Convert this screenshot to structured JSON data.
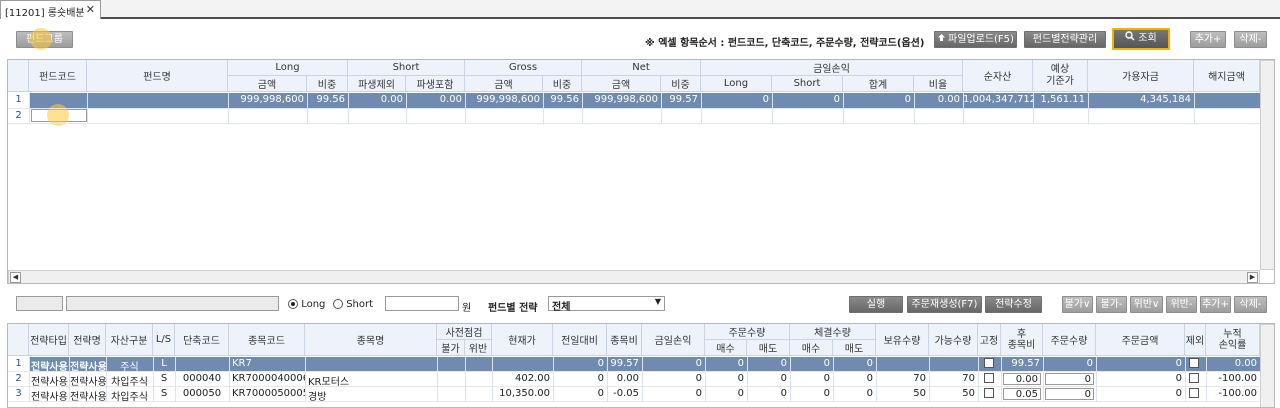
{
  "tab": {
    "title": "[11201] 롱숏배분",
    "close": "✕"
  },
  "toolbar": {
    "fund_group": "펀드그룹",
    "excel_note": "※ 엑셀 항목순서 : 펀드코드, 단축코드, 주문수량, 전략코드(옵션)",
    "upload": "파일업로드(F5)",
    "strategy_manage": "펀드별전략관리",
    "search": "조회",
    "add": "추가+",
    "delete": "삭제-"
  },
  "top_grid": {
    "group_headers": [
      "Long",
      "Short",
      "Gross",
      "Net",
      "금일손익"
    ],
    "headers": {
      "fund_code": "펀드코드",
      "fund_name": "펀드명",
      "long_amt": "금액",
      "long_ratio": "비중",
      "short_ex": "파생제외",
      "short_in": "파생포함",
      "gross_amt": "금액",
      "gross_ratio": "비중",
      "net_amt": "금액",
      "net_ratio": "비중",
      "pl_long": "Long",
      "pl_short": "Short",
      "pl_sum": "합계",
      "pl_rate": "비율",
      "net_asset": "순자산",
      "expected": "예상\n기준가",
      "available": "가용자금",
      "cancel": "해지금액"
    },
    "rows": [
      {
        "no": "1",
        "cells": [
          "999,998,600",
          "99.56",
          "0.00",
          "0.00",
          "999,998,600",
          "99.56",
          "999,998,600",
          "99.57",
          "0",
          "0",
          "0",
          "0.00",
          "1,004,347,712",
          "1,561.11",
          "4,345,184"
        ]
      },
      {
        "no": "2"
      }
    ]
  },
  "mid_toolbar": {
    "long": "Long",
    "short": "Short",
    "won": "원",
    "strategy_label": "펀드별 전략",
    "strategy_value": "전체",
    "run": "실행",
    "order_regen": "주문재생성(F7)",
    "strategy_edit": "전략수정",
    "buttons": [
      "불가∨",
      "불가-",
      "위반∨",
      "위반-",
      "추가+",
      "삭제-"
    ]
  },
  "bottom_grid": {
    "headers": {
      "strategy_type": "전략타입",
      "strategy_name": "전략명",
      "asset_type": "자산구분",
      "ls": "L/S",
      "short_code": "단축코드",
      "item_code": "종목코드",
      "item_name": "종목명",
      "precheck": "사전점검",
      "impossible": "불가",
      "violation": "위반",
      "price": "현재가",
      "change": "전일대비",
      "weight": "종목비",
      "today_pl": "금일손익",
      "order_qty_group": "주문수량",
      "buy": "매수",
      "sell": "매도",
      "exec_qty_group": "체결수량",
      "exec_buy": "매수",
      "exec_sell": "매도",
      "hold_qty": "보유수량",
      "avail_qty": "가능수량",
      "fixed": "고정",
      "after_weight": "후\n종목비",
      "order_qty": "주문수량",
      "order_amt": "주문금액",
      "exclude": "제외",
      "cum_rate": "누적\n손익률"
    },
    "rows": [
      {
        "no": "1",
        "st": "전략사용",
        "sn": "전략사용",
        "asset": "주식",
        "ls": "L",
        "sc": "",
        "ic": "KR7",
        "nm": "",
        "price": "",
        "chg": "0",
        "w": "99.57",
        "pl": "0",
        "b": "0",
        "s": "0",
        "eb": "0",
        "es": "0",
        "hq": "",
        "aq": "",
        "aw": "99.57",
        "oq": "0",
        "oa": "0",
        "cr": "0.00"
      },
      {
        "no": "2",
        "st": "전략사용",
        "sn": "전략사용",
        "asset": "차입주식",
        "ls": "S",
        "sc": "000040",
        "ic": "KR7000040006",
        "nm": "KR모터스",
        "price": "402.00",
        "chg": "0",
        "w": "0.00",
        "pl": "0",
        "b": "0",
        "s": "0",
        "eb": "0",
        "es": "0",
        "hq": "70",
        "aq": "70",
        "aw": "0.00",
        "oq": "0",
        "oa": "0",
        "cr": "-100.00"
      },
      {
        "no": "3",
        "st": "전략사용",
        "sn": "전략사용",
        "asset": "차입주식",
        "ls": "S",
        "sc": "000050",
        "ic": "KR7000050005",
        "nm": "경방",
        "price": "10,350.00",
        "chg": "0",
        "w": "-0.05",
        "pl": "0",
        "b": "0",
        "s": "0",
        "eb": "0",
        "es": "0",
        "hq": "50",
        "aq": "50",
        "aw": "0.05",
        "oq": "0",
        "oa": "0",
        "cr": "-100.00"
      }
    ]
  }
}
